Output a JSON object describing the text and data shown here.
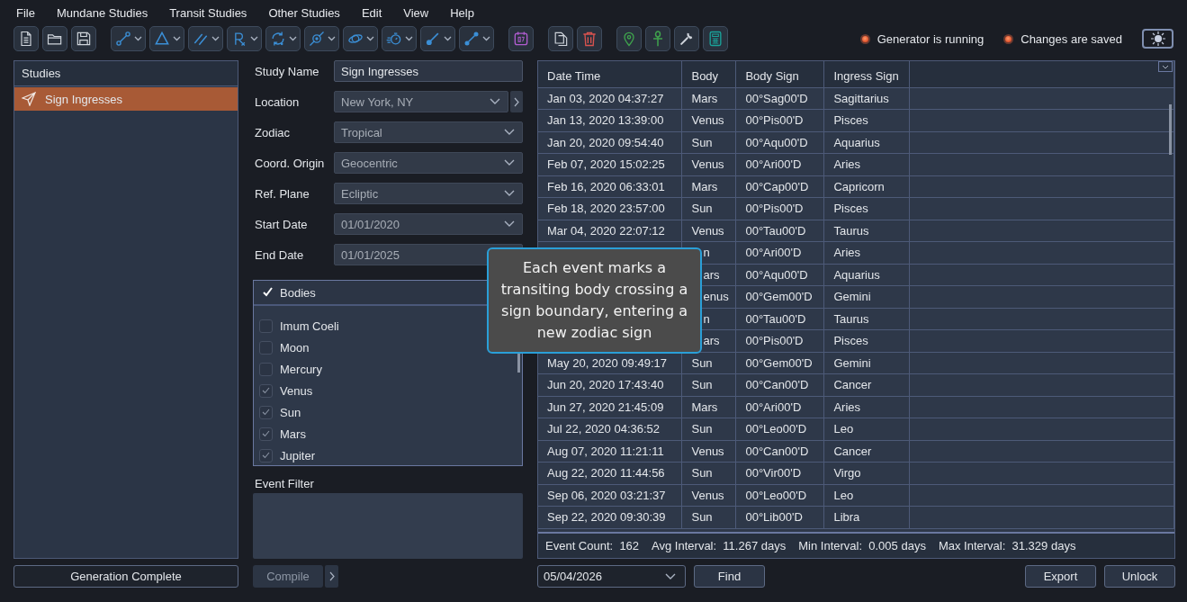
{
  "menu": [
    "File",
    "Mundane Studies",
    "Transit Studies",
    "Other Studies",
    "Edit",
    "View",
    "Help"
  ],
  "status": [
    {
      "label": "Generator is running",
      "on": true
    },
    {
      "label": "Changes are saved",
      "on": true
    }
  ],
  "studies": {
    "title": "Studies",
    "items": [
      {
        "label": "Sign Ingresses",
        "selected": true
      }
    ],
    "footer_button": "Generation Complete"
  },
  "form": {
    "fields": [
      {
        "label": "Study Name",
        "kind": "input",
        "value": "Sign Ingresses"
      },
      {
        "label": "Location",
        "kind": "location",
        "value": "New York, NY"
      },
      {
        "label": "Zodiac",
        "kind": "select",
        "value": "Tropical"
      },
      {
        "label": "Coord. Origin",
        "kind": "select",
        "value": "Geocentric"
      },
      {
        "label": "Ref. Plane",
        "kind": "select",
        "value": "Ecliptic"
      },
      {
        "label": "Start Date",
        "kind": "select",
        "value": "01/01/2020"
      },
      {
        "label": "End Date",
        "kind": "date",
        "value": "01/01/2025"
      }
    ],
    "bodies": {
      "title": "Bodies",
      "checked": true,
      "items": [
        {
          "label": "Imum Coeli",
          "checked": false
        },
        {
          "label": "Moon",
          "checked": false
        },
        {
          "label": "Mercury",
          "checked": false
        },
        {
          "label": "Venus",
          "checked": true
        },
        {
          "label": "Sun",
          "checked": true
        },
        {
          "label": "Mars",
          "checked": true
        },
        {
          "label": "Jupiter",
          "checked": true
        }
      ]
    },
    "event_filter_label": "Event Filter",
    "compile_button": "Compile"
  },
  "table": {
    "columns": [
      "Date Time",
      "Body",
      "Body Sign",
      "Ingress Sign"
    ],
    "rows": [
      {
        "date_time": "Jan 03, 2020 04:37:27",
        "body": "Mars",
        "body_sign": "00°Sag00'D",
        "ingress_sign": "Sagittarius"
      },
      {
        "date_time": "Jan 13, 2020 13:39:00",
        "body": "Venus",
        "body_sign": "00°Pis00'D",
        "ingress_sign": "Pisces"
      },
      {
        "date_time": "Jan 20, 2020 09:54:40",
        "body": "Sun",
        "body_sign": "00°Aqu00'D",
        "ingress_sign": "Aquarius"
      },
      {
        "date_time": "Feb 07, 2020 15:02:25",
        "body": "Venus",
        "body_sign": "00°Ari00'D",
        "ingress_sign": "Aries"
      },
      {
        "date_time": "Feb 16, 2020 06:33:01",
        "body": "Mars",
        "body_sign": "00°Cap00'D",
        "ingress_sign": "Capricorn"
      },
      {
        "date_time": "Feb 18, 2020 23:57:00",
        "body": "Sun",
        "body_sign": "00°Pis00'D",
        "ingress_sign": "Pisces"
      },
      {
        "date_time": "Mar 04, 2020 22:07:12",
        "body": "Venus",
        "body_sign": "00°Tau00'D",
        "ingress_sign": "Taurus"
      },
      {
        "body": "n",
        "body_sign": "00°Ari00'D",
        "ingress_sign": "Aries"
      },
      {
        "body": "ars",
        "body_sign": "00°Aqu00'D",
        "ingress_sign": "Aquarius"
      },
      {
        "body": "enus",
        "body_sign": "00°Gem00'D",
        "ingress_sign": "Gemini"
      },
      {
        "body": "n",
        "body_sign": "00°Tau00'D",
        "ingress_sign": "Taurus"
      },
      {
        "body": "ars",
        "body_sign": "00°Pis00'D",
        "ingress_sign": "Pisces"
      },
      {
        "date_time": "May 20, 2020 09:49:17",
        "body": "Sun",
        "body_sign": "00°Gem00'D",
        "ingress_sign": "Gemini"
      },
      {
        "date_time": "Jun 20, 2020 17:43:40",
        "body": "Sun",
        "body_sign": "00°Can00'D",
        "ingress_sign": "Cancer"
      },
      {
        "date_time": "Jun 27, 2020 21:45:09",
        "body": "Mars",
        "body_sign": "00°Ari00'D",
        "ingress_sign": "Aries"
      },
      {
        "date_time": "Jul 22, 2020 04:36:52",
        "body": "Sun",
        "body_sign": "00°Leo00'D",
        "ingress_sign": "Leo"
      },
      {
        "date_time": "Aug 07, 2020 11:21:11",
        "body": "Venus",
        "body_sign": "00°Can00'D",
        "ingress_sign": "Cancer"
      },
      {
        "date_time": "Aug 22, 2020 11:44:56",
        "body": "Sun",
        "body_sign": "00°Vir00'D",
        "ingress_sign": "Virgo"
      },
      {
        "date_time": "Sep 06, 2020 03:21:37",
        "body": "Venus",
        "body_sign": "00°Leo00'D",
        "ingress_sign": "Leo"
      },
      {
        "date_time": "Sep 22, 2020 09:30:39",
        "body": "Sun",
        "body_sign": "00°Lib00'D",
        "ingress_sign": "Libra"
      }
    ],
    "stats": [
      {
        "label": "Event Count:",
        "value": "162"
      },
      {
        "label": "Avg Interval:",
        "value": "11.267 days"
      },
      {
        "label": "Min Interval:",
        "value": "0.005 days"
      },
      {
        "label": "Max Interval:",
        "value": "31.329 days"
      }
    ]
  },
  "bottom": {
    "date": "05/04/2026",
    "find_button": "Find",
    "export_button": "Export",
    "unlock_button": "Unlock"
  },
  "tooltip": "Each event marks a transiting body crossing a sign boundary, entering a new zodiac sign"
}
